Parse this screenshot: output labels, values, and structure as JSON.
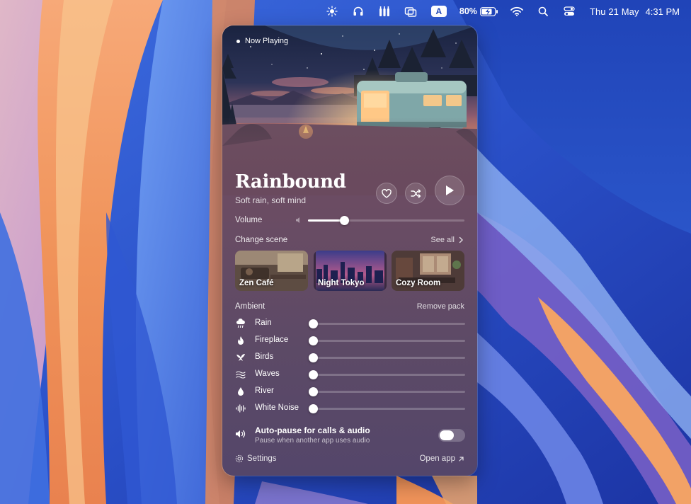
{
  "menubar": {
    "icons": [
      "sun-icon",
      "headphones-icon",
      "bottles-icon",
      "window-stack-icon"
    ],
    "input_source": "A",
    "battery_percent": "80%",
    "date": "Thu 21 May",
    "time": "4:31 PM"
  },
  "panel": {
    "now_playing": "Now Playing",
    "track": {
      "title": "Rainbound",
      "subtitle": "Soft rain, soft mind"
    },
    "volume": {
      "label": "Volume",
      "level": 0.23
    },
    "scenes": {
      "label": "Change scene",
      "see_all": "See all",
      "items": [
        {
          "name": "Zen Café"
        },
        {
          "name": "Night Tokyo"
        },
        {
          "name": "Cozy Room"
        }
      ]
    },
    "ambient": {
      "label": "Ambient",
      "remove_pack": "Remove pack",
      "items": [
        {
          "label": "Rain",
          "icon": "cloud-rain-icon",
          "level": 0
        },
        {
          "label": "Fireplace",
          "icon": "flame-icon",
          "level": 0
        },
        {
          "label": "Birds",
          "icon": "bird-icon",
          "level": 0
        },
        {
          "label": "Waves",
          "icon": "waves-icon",
          "level": 0
        },
        {
          "label": "River",
          "icon": "droplet-icon",
          "level": 0
        },
        {
          "label": "White Noise",
          "icon": "waveform-icon",
          "level": 0
        }
      ]
    },
    "autopause": {
      "title": "Auto-pause for calls & audio",
      "subtitle": "Pause when another app uses audio",
      "enabled": false
    },
    "footer": {
      "settings": "Settings",
      "open_app": "Open app"
    }
  }
}
